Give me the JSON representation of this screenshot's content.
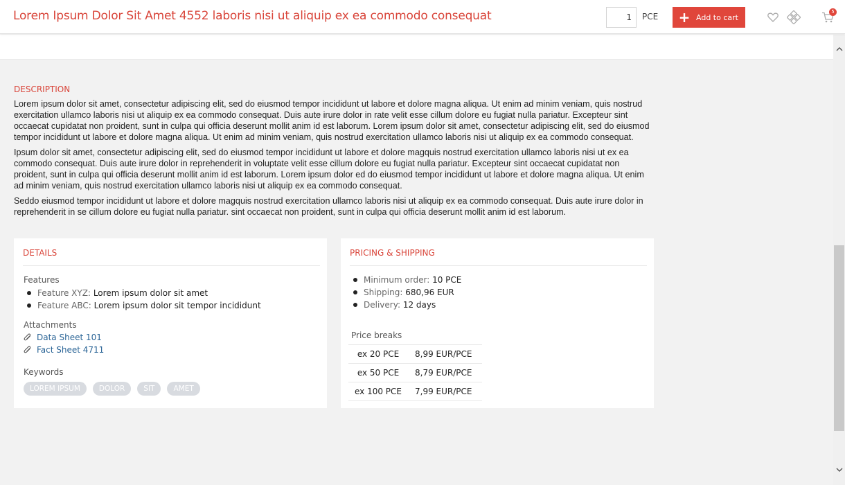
{
  "header": {
    "title": "Lorem Ipsum Dolor Sit Amet 4552 laboris nisi ut aliquip ex ea commodo consequat",
    "quantity": "1",
    "unit": "PCE",
    "add_to_cart_label": "Add to cart",
    "cart_count": "5",
    "icons": [
      "plus-icon",
      "heart-icon",
      "compare-icon",
      "cart-icon"
    ]
  },
  "description": {
    "label": "DESCRIPTION",
    "paragraphs": [
      "Lorem ipsum dolor sit amet, consectetur adipiscing elit, sed do eiusmod tempor incididunt ut labore et dolore magna aliqua. Ut enim ad minim veniam, quis nostrud exercitation ullamco laboris nisi ut aliquip ex ea commodo consequat. Duis aute irure dolor in rate velit esse cillum dolore eu fugiat nulla pariatur. Excepteur sint occaecat cupidatat non proident, sunt in culpa qui officia deserunt mollit anim id est laborum. Lorem ipsum dolor sit amet, consectetur adipiscing elit, sed do eiusmod tempor incididunt ut labore et dolore magna aliqua. Ut enim ad minim veniam, quis nostrud exercitation ullamco laboris nisi ut aliquip ex ea commodo consequat.",
      "Ipsum dolor sit amet, consectetur adipiscing elit, sed do eiusmod tempor incididunt ut labore et dolore magquis nostrud exercitation ullamco laboris nisi ut ex ea commodo consequat. Duis aute irure dolor in reprehenderit in voluptate velit esse cillum dolore eu fugiat nulla pariatur. Excepteur sint occaecat cupidatat non proident, sunt in culpa qui officia deserunt mollit anim id est laborum. Lorem ipsum dolor ed do eiusmod tempor incididunt ut labore et dolore magna aliqua. Ut enim ad minim veniam, quis nostrud exercitation ullamco laboris nisi ut aliquip ex ea commodo consequat.",
      "Seddo eiusmod tempor incididunt ut labore et dolore magquis nostrud exercitation ullamco laboris nisi ut aliquip ex ea commodo consequat. Duis aute irure dolor in reprehenderit in se cillum dolore eu fugiat nulla pariatur. sint occaecat non proident, sunt in culpa qui officia deserunt mollit anim id est laborum."
    ]
  },
  "details": {
    "heading": "DETAILS",
    "features_label": "Features",
    "features": [
      {
        "name": "Feature XYZ:",
        "value": "Lorem ipsum dolor sit amet"
      },
      {
        "name": "Feature ABC:",
        "value": "Lorem ipsum dolor sit tempor incididunt"
      }
    ],
    "attachments_label": "Attachments",
    "attachments": [
      "Data Sheet 101",
      "Fact Sheet 4711"
    ],
    "keywords_label": "Keywords",
    "keywords": [
      "LOREM IPSUM",
      "DOLOR",
      "SIT",
      "AMET"
    ]
  },
  "pricing": {
    "heading": "PRICING & SHIPPING",
    "items": [
      {
        "name": "Minimum order:",
        "value": "10 PCE"
      },
      {
        "name": "Shipping:",
        "value": " 680,96 EUR"
      },
      {
        "name": "Delivery:",
        "value": "12 days"
      }
    ],
    "price_breaks_label": "Price breaks",
    "price_breaks": [
      {
        "qty": "ex 20 PCE",
        "price": "8,99 EUR/PCE"
      },
      {
        "qty": "ex 50 PCE",
        "price": "8,79 EUR/PCE"
      },
      {
        "qty": "ex 100 PCE",
        "price": "7,99 EUR/PCE"
      }
    ]
  },
  "colors": {
    "accent": "#e0463b",
    "link": "#2a6496",
    "tag_bg": "#d8dbe0"
  }
}
